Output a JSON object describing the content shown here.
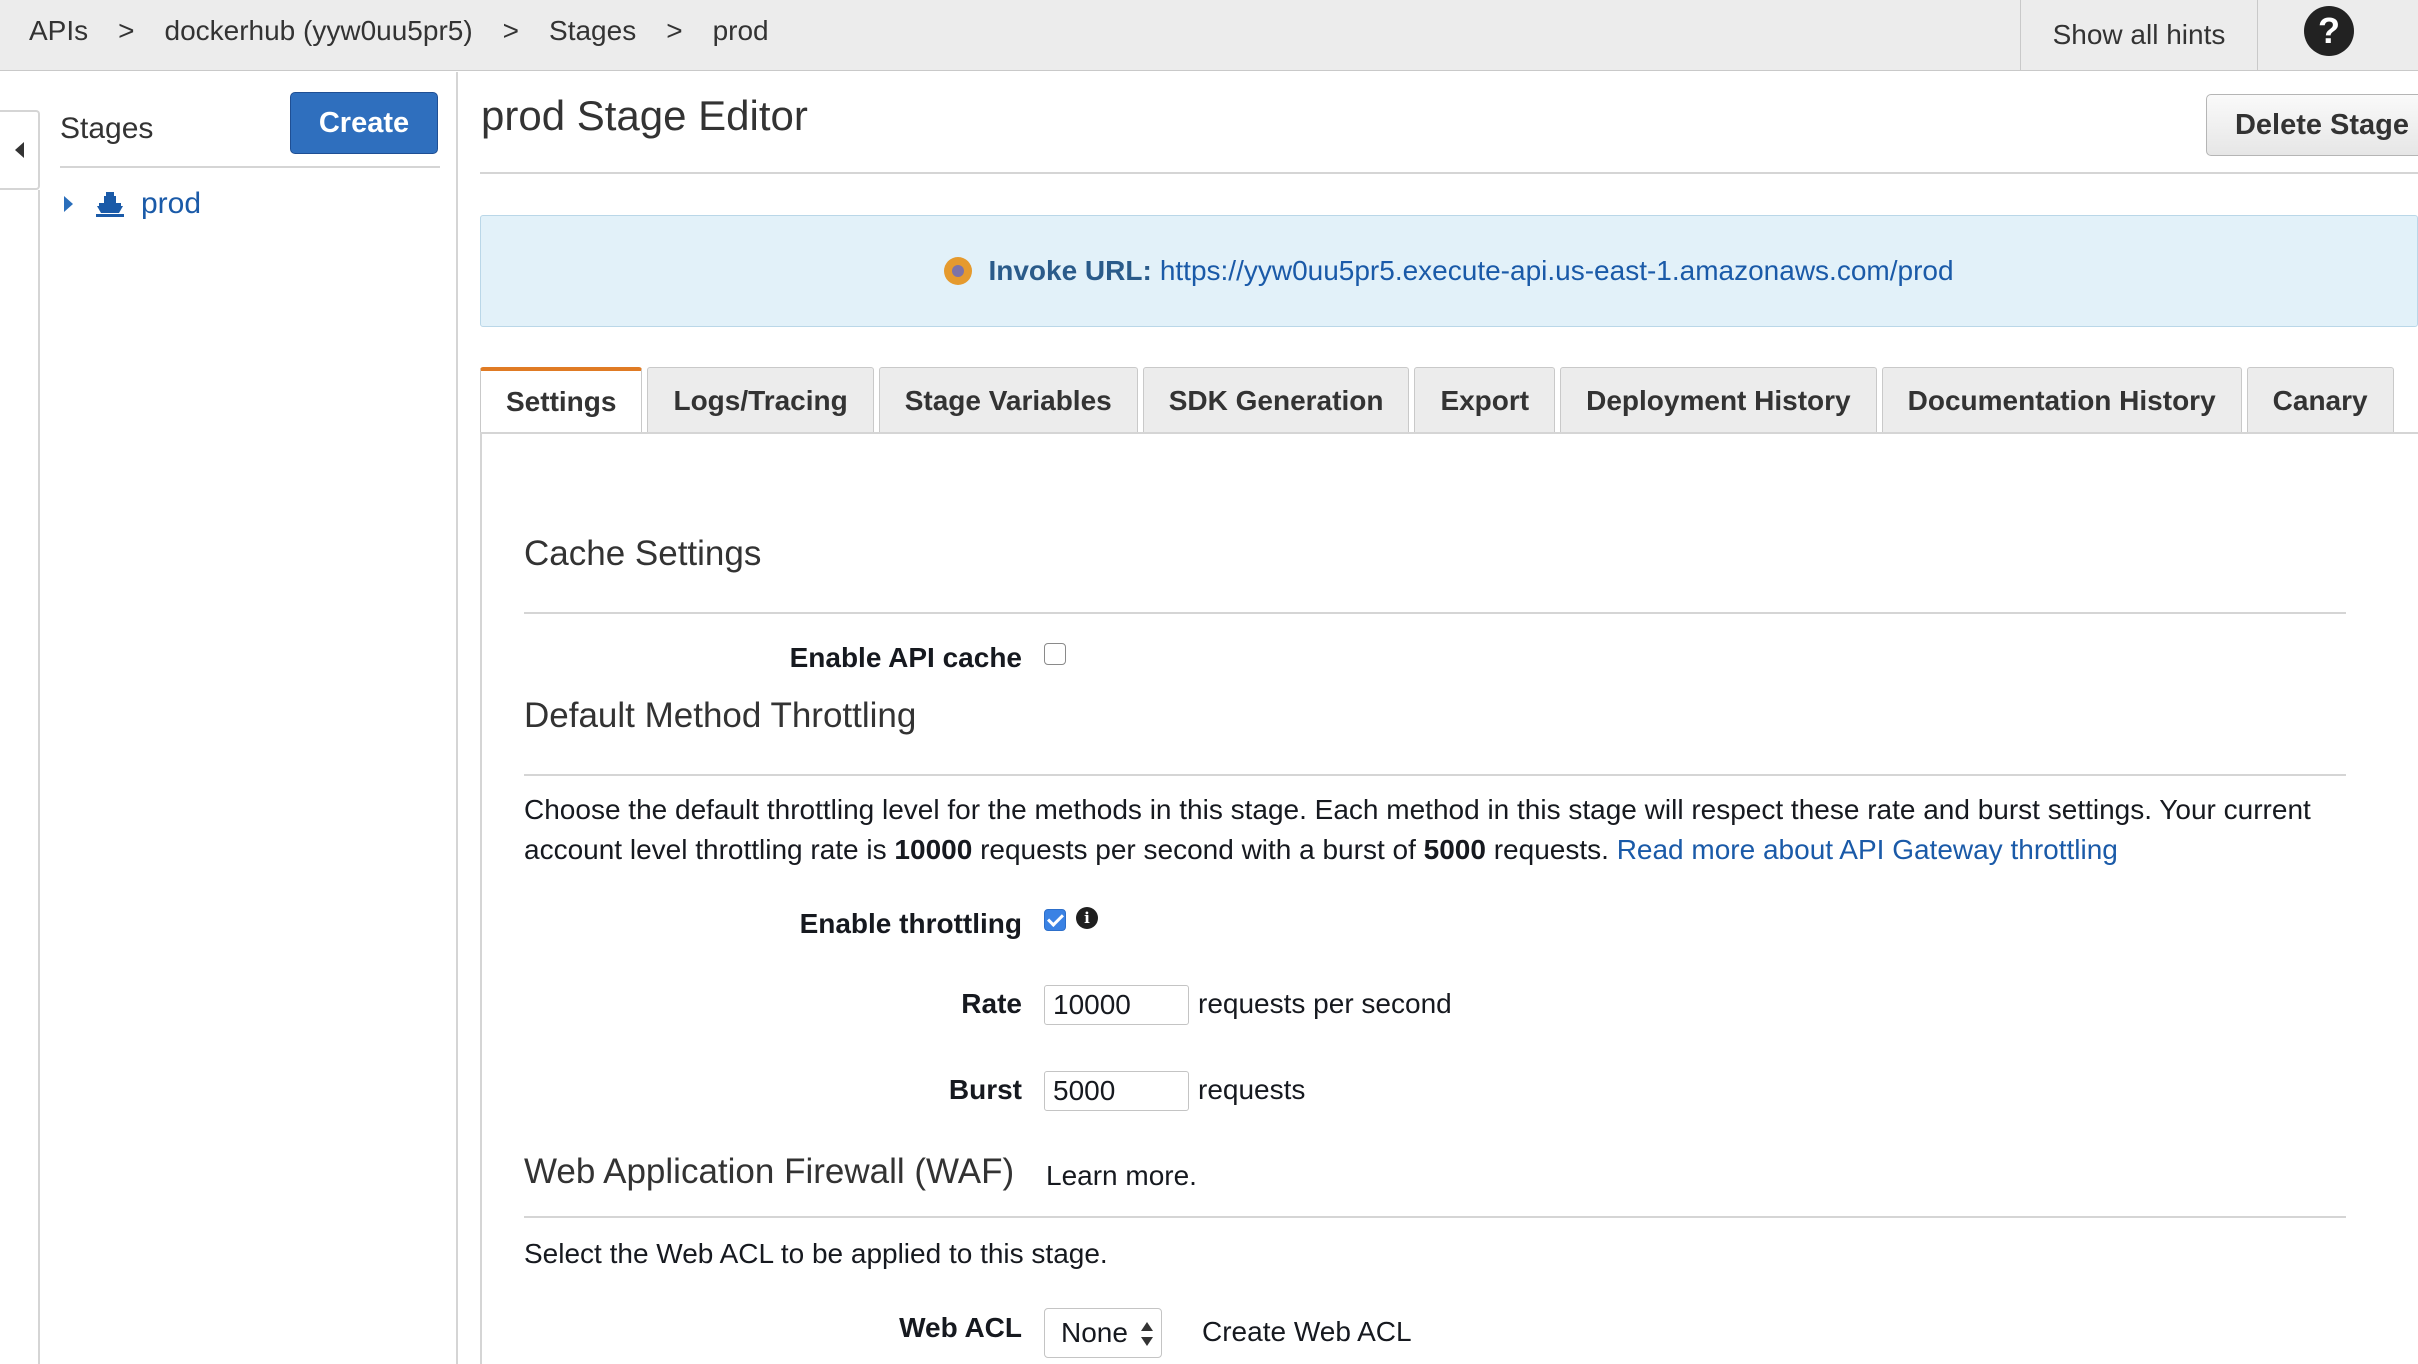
{
  "breadcrumb": {
    "items": [
      "APIs",
      "dockerhub (yyw0uu5pr5)",
      "Stages",
      "prod"
    ],
    "separator": ">"
  },
  "header": {
    "show_hints_label": "Show all hints",
    "help_icon_glyph": "?"
  },
  "sidebar": {
    "title": "Stages",
    "create_label": "Create",
    "items": [
      {
        "label": "prod",
        "icon": "stage-icon"
      }
    ]
  },
  "main": {
    "title": "prod Stage Editor",
    "delete_label": "Delete Stage",
    "invoke": {
      "label": "Invoke URL:",
      "url": "https://yyw0uu5pr5.execute-api.us-east-1.amazonaws.com/prod"
    },
    "tabs": [
      {
        "label": "Settings",
        "active": true
      },
      {
        "label": "Logs/Tracing",
        "active": false
      },
      {
        "label": "Stage Variables",
        "active": false
      },
      {
        "label": "SDK Generation",
        "active": false
      },
      {
        "label": "Export",
        "active": false
      },
      {
        "label": "Deployment History",
        "active": false
      },
      {
        "label": "Documentation History",
        "active": false
      },
      {
        "label": "Canary",
        "active": false
      }
    ]
  },
  "settings": {
    "cache": {
      "title": "Cache Settings",
      "enable_label": "Enable API cache",
      "enabled": false
    },
    "throttling": {
      "title": "Default Method Throttling",
      "desc_part1": "Choose the default throttling level for the methods in this stage. Each method in this stage will respect these rate and burst settings. Your current account level throttling rate is ",
      "account_rate": "10000",
      "desc_part2": " requests per second with a burst of ",
      "account_burst": "5000",
      "desc_part3": " requests. ",
      "read_more": "Read more about API Gateway throttling",
      "enable_label": "Enable throttling",
      "enabled": true,
      "rate_label": "Rate",
      "rate_value": "10000",
      "rate_unit": "requests per second",
      "burst_label": "Burst",
      "burst_value": "5000",
      "burst_unit": "requests"
    },
    "waf": {
      "title": "Web Application Firewall (WAF)",
      "learn_more": "Learn more.",
      "desc": "Select the Web ACL to be applied to this stage.",
      "acl_label": "Web ACL",
      "acl_value": "None",
      "create_link": "Create Web ACL"
    }
  },
  "colors": {
    "accent_blue": "#2f6fbe",
    "link_blue": "#1a5aa8",
    "tab_active": "#e07b24",
    "invoke_bg": "#e2f1f9",
    "invoke_dot": "#e59a2e"
  }
}
